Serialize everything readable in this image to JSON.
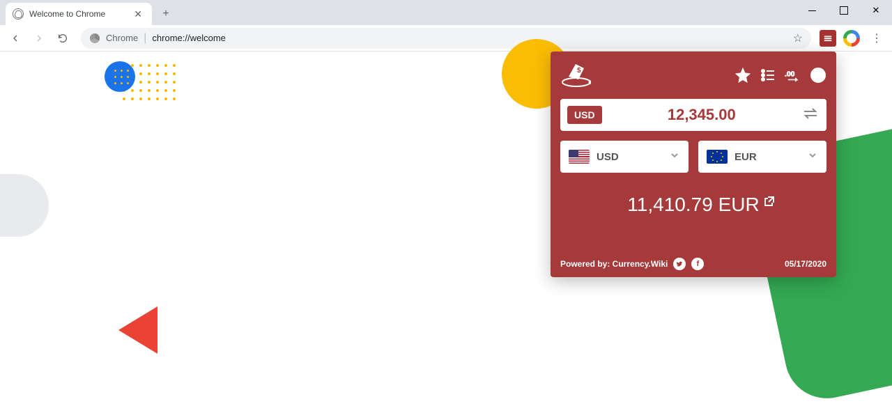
{
  "window": {
    "tab_title": "Welcome to Chrome"
  },
  "omnibox": {
    "origin": "Chrome",
    "url": "chrome://welcome"
  },
  "popup": {
    "badge": "USD",
    "amount": "12,345.00",
    "from": {
      "code": "USD"
    },
    "to": {
      "code": "EUR"
    },
    "result_value": "11,410.79",
    "result_currency": "EUR",
    "powered_by": "Powered by: Currency.Wiki",
    "date": "05/17/2020"
  }
}
